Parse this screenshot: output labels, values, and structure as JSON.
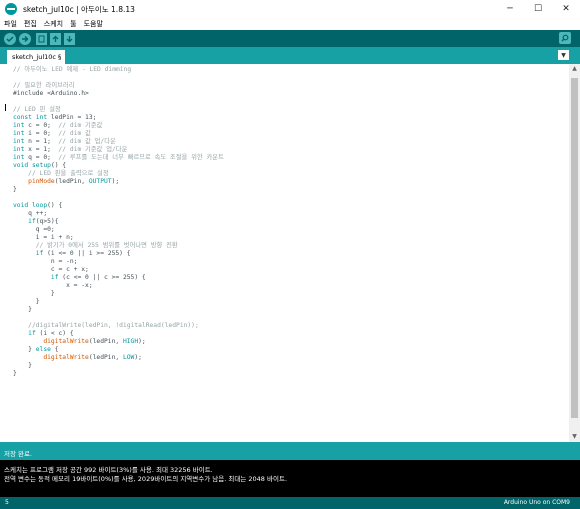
{
  "window": {
    "title": "sketch_jul10c | 아두이노 1.8.13",
    "minimize": "─",
    "maximize": "☐",
    "close": "✕"
  },
  "menu": [
    "파일",
    "편집",
    "스케치",
    "툴",
    "도움말"
  ],
  "toolbar": {
    "verify_icon": "✓",
    "upload_icon": "→",
    "new_icon": "▤",
    "open_icon": "↑",
    "save_icon": "↓",
    "serial_monitor_icon": "⌕"
  },
  "tab": {
    "label": "sketch_jul10c §",
    "menu_icon": "▼"
  },
  "code_lines": [
    [
      {
        "t": "// 아두이노 LED 예제 - LED dimming",
        "c": "comment"
      }
    ],
    [],
    [
      {
        "t": "// 필요한 라이브러리",
        "c": "comment"
      }
    ],
    [
      {
        "t": "#include <Arduino.h>",
        "c": ""
      }
    ],
    [],
    [
      {
        "t": "// LED 핀 설정",
        "c": "comment"
      }
    ],
    [
      {
        "t": "const",
        "c": "kw"
      },
      {
        "t": " ",
        "c": ""
      },
      {
        "t": "int",
        "c": "kw"
      },
      {
        "t": " ledPin = 13;",
        "c": ""
      }
    ],
    [
      {
        "t": "int",
        "c": "kw"
      },
      {
        "t": " c = 0;  ",
        "c": ""
      },
      {
        "t": "// dim 기준값",
        "c": "comment"
      }
    ],
    [
      {
        "t": "int",
        "c": "kw"
      },
      {
        "t": " i = 0;  ",
        "c": ""
      },
      {
        "t": "// dim 값",
        "c": "comment"
      }
    ],
    [
      {
        "t": "int",
        "c": "kw"
      },
      {
        "t": " n = 1;  ",
        "c": ""
      },
      {
        "t": "// dim 값 업/다운",
        "c": "comment"
      }
    ],
    [
      {
        "t": "int",
        "c": "kw"
      },
      {
        "t": " x = 1;  ",
        "c": ""
      },
      {
        "t": "// dim 기준값 업/다운",
        "c": "comment"
      }
    ],
    [
      {
        "t": "int",
        "c": "kw"
      },
      {
        "t": " q = 0;  ",
        "c": ""
      },
      {
        "t": "// 루프를 도는데 너무 빠르므로 속도 조절을 위한 카운트",
        "c": "comment"
      }
    ],
    [
      {
        "t": "void",
        "c": "kw"
      },
      {
        "t": " ",
        "c": ""
      },
      {
        "t": "setup",
        "c": "kw"
      },
      {
        "t": "() {",
        "c": ""
      }
    ],
    [
      {
        "t": "    ",
        "c": ""
      },
      {
        "t": "// LED 핀을 출력으로 설정",
        "c": "comment"
      }
    ],
    [
      {
        "t": "    ",
        "c": ""
      },
      {
        "t": "pinMode",
        "c": "fn"
      },
      {
        "t": "(ledPin, ",
        "c": ""
      },
      {
        "t": "OUTPUT",
        "c": "kw"
      },
      {
        "t": ");",
        "c": ""
      }
    ],
    [
      {
        "t": "}",
        "c": ""
      }
    ],
    [],
    [
      {
        "t": "void",
        "c": "kw"
      },
      {
        "t": " ",
        "c": ""
      },
      {
        "t": "loop",
        "c": "kw"
      },
      {
        "t": "() {",
        "c": ""
      }
    ],
    [
      {
        "t": "    q ++;",
        "c": ""
      }
    ],
    [
      {
        "t": "    ",
        "c": ""
      },
      {
        "t": "if",
        "c": "kw"
      },
      {
        "t": "(q>5){",
        "c": ""
      }
    ],
    [
      {
        "t": "      q =0;",
        "c": ""
      }
    ],
    [
      {
        "t": "      i = i + n;",
        "c": ""
      }
    ],
    [
      {
        "t": "      ",
        "c": ""
      },
      {
        "t": "// 밝기가 0에서 255 범위를 벗어나면 방향 전환",
        "c": "comment"
      }
    ],
    [
      {
        "t": "      ",
        "c": ""
      },
      {
        "t": "if",
        "c": "kw"
      },
      {
        "t": " (i <= 0 || i >= 255) {",
        "c": ""
      }
    ],
    [
      {
        "t": "          n = -n;",
        "c": ""
      }
    ],
    [
      {
        "t": "          c = c + x;",
        "c": ""
      }
    ],
    [
      {
        "t": "          ",
        "c": ""
      },
      {
        "t": "if",
        "c": "kw"
      },
      {
        "t": " (c <= 0 || c >= 255) {",
        "c": ""
      }
    ],
    [
      {
        "t": "              x = -x;",
        "c": ""
      }
    ],
    [
      {
        "t": "          }",
        "c": ""
      }
    ],
    [
      {
        "t": "      }",
        "c": ""
      }
    ],
    [
      {
        "t": "    }",
        "c": ""
      }
    ],
    [],
    [
      {
        "t": "    ",
        "c": ""
      },
      {
        "t": "//digitalWrite(ledPin, !digitalRead(ledPin));",
        "c": "comment"
      }
    ],
    [
      {
        "t": "    ",
        "c": ""
      },
      {
        "t": "if",
        "c": "kw"
      },
      {
        "t": " (i < c) {",
        "c": ""
      }
    ],
    [
      {
        "t": "        ",
        "c": ""
      },
      {
        "t": "digitalWrite",
        "c": "fn"
      },
      {
        "t": "(ledPin, ",
        "c": ""
      },
      {
        "t": "HIGH",
        "c": "kw"
      },
      {
        "t": ");",
        "c": ""
      }
    ],
    [
      {
        "t": "    } ",
        "c": ""
      },
      {
        "t": "else",
        "c": "kw"
      },
      {
        "t": " {",
        "c": ""
      }
    ],
    [
      {
        "t": "        ",
        "c": ""
      },
      {
        "t": "digitalWrite",
        "c": "fn"
      },
      {
        "t": "(ledPin, ",
        "c": ""
      },
      {
        "t": "LOW",
        "c": "kw"
      },
      {
        "t": ");",
        "c": ""
      }
    ],
    [
      {
        "t": "    }",
        "c": ""
      }
    ],
    [
      {
        "t": "}",
        "c": ""
      }
    ]
  ],
  "status": {
    "text": "저장 완료."
  },
  "console": {
    "lines": [
      "스케치는 프로그램 저장 공간 992 바이트(3%)를 사용. 최대 32256 바이트.",
      "전역 변수는 동적 메모리 19바이트(0%)를 사용, 2029바이트의 지역변수가 남음.  최대는 2048 바이트."
    ]
  },
  "footer": {
    "line_number": "5",
    "board": "Arduino Uno on COM9"
  },
  "colors": {
    "toolbar_bg": "#006468",
    "tab_bar_bg": "#17a1a5",
    "button_bg": "#4db7bb",
    "keyword": "#00979d",
    "function": "#d35400",
    "comment": "#95a5a6"
  }
}
